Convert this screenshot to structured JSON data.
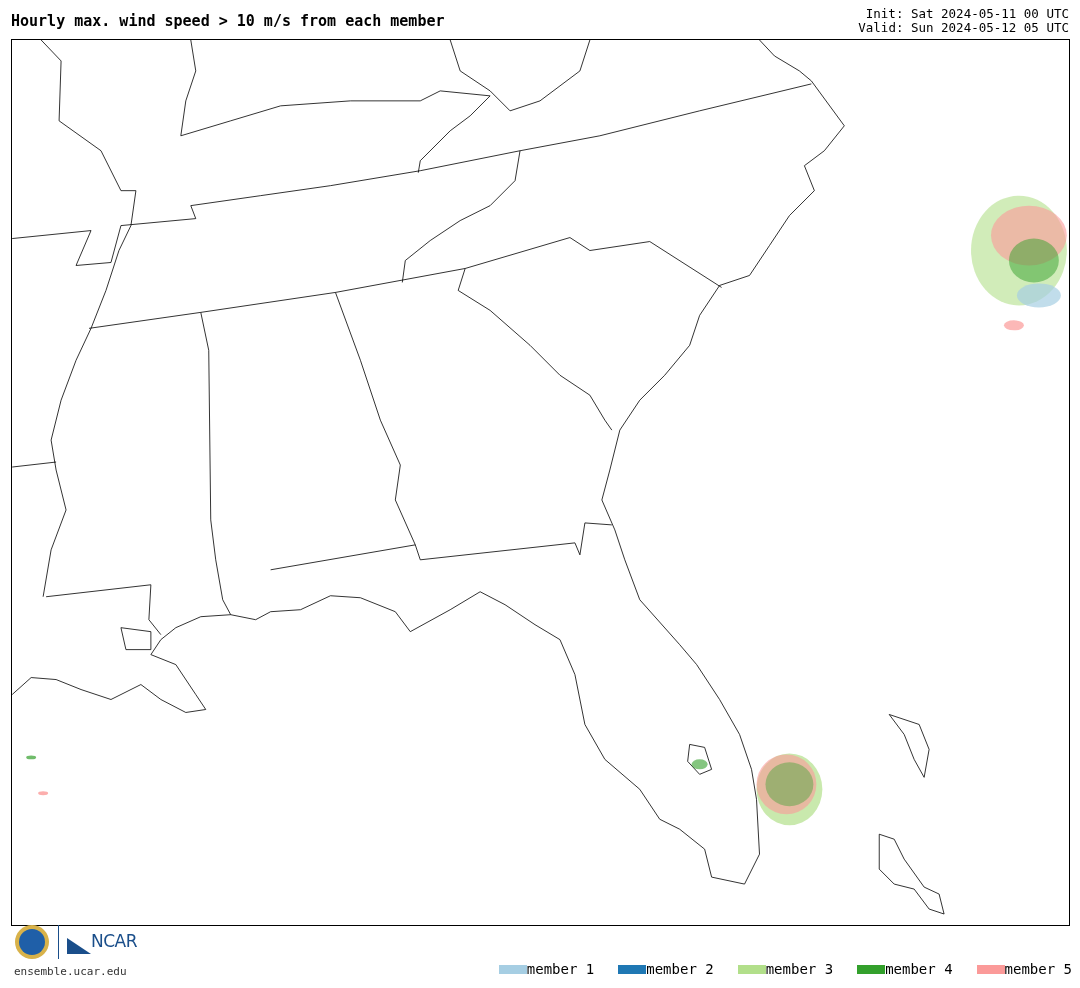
{
  "title": "Hourly max. wind speed > 10 m/s from each member",
  "init": "Init: Sat 2024-05-11 00 UTC",
  "valid": "Valid: Sun 2024-05-12 05 UTC",
  "logo": {
    "text": "NCAR"
  },
  "site": "ensemble.ucar.edu",
  "legend": [
    {
      "label": "member 1",
      "color": "#a6cee3"
    },
    {
      "label": "member 2",
      "color": "#1f78b4"
    },
    {
      "label": "member 3",
      "color": "#b2df8a"
    },
    {
      "label": "member 4",
      "color": "#33a02c"
    },
    {
      "label": "member 5",
      "color": "#fb9a99"
    }
  ]
}
